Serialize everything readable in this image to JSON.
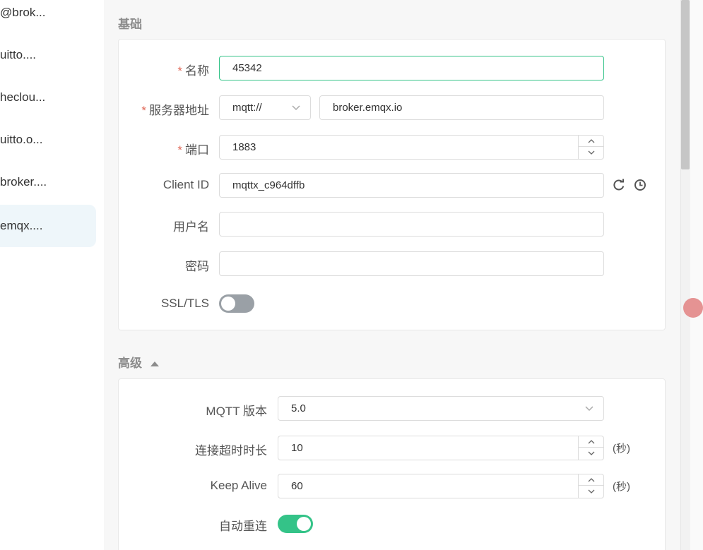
{
  "connections": [
    {
      "label": "@brok..."
    },
    {
      "label": "uitto...."
    },
    {
      "label": "heclou..."
    },
    {
      "label": "uitto.o..."
    },
    {
      "label": "broker...."
    },
    {
      "label": "emqx...."
    }
  ],
  "basic": {
    "section_title": "基础",
    "name_label": "名称",
    "name_value": "45342",
    "host_label": "服务器地址",
    "protocol_value": "mqtt://",
    "host_value": "broker.emqx.io",
    "port_label": "端口",
    "port_value": "1883",
    "client_id_label": "Client ID",
    "client_id_value": "mqttx_c964dffb",
    "username_label": "用户名",
    "username_value": "",
    "password_label": "密码",
    "password_value": "",
    "ssl_label": "SSL/TLS",
    "ssl_enabled": false,
    "required_mark": "*"
  },
  "advanced": {
    "section_title": "高级",
    "mqtt_version_label": "MQTT 版本",
    "mqtt_version_value": "5.0",
    "connect_timeout_label": "连接超时时长",
    "connect_timeout_value": "10",
    "connect_timeout_unit": "(秒)",
    "keep_alive_label": "Keep Alive",
    "keep_alive_value": "60",
    "keep_alive_unit": "(秒)",
    "auto_reconnect_label": "自动重连",
    "auto_reconnect_enabled": true
  },
  "colors": {
    "accent_green": "#34c388",
    "toggle_off": "#9aa0a6",
    "required_red": "#e06a5a",
    "active_item_bg": "#eef6fa"
  },
  "icons": {
    "refresh": "refresh-icon",
    "history": "clock-icon",
    "collapse": "caret-up-icon",
    "dropdown": "chevron-down-icon"
  }
}
